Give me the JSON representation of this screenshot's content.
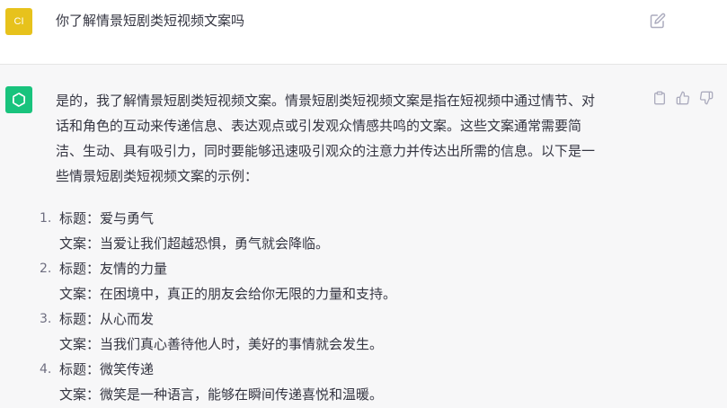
{
  "colors": {
    "user_avatar_bg": "#e7c21c",
    "assistant_avatar_bg": "#19c37d",
    "icon_gray": "#acacbe"
  },
  "user_message": {
    "avatar_initials": "CI",
    "text": "你了解情景短剧类短视频文案吗",
    "edit_icon": "edit-icon"
  },
  "assistant_message": {
    "avatar_icon": "openai-logo-icon",
    "intro_lines": [
      "是的，我了解情景短剧类短视频文案。情景短剧类短视频文案是指在短视频中通过情节、对",
      "话和角色的互动来传递信息、表达观点或引发观众情感共鸣的文案。这些文案通常需要简",
      "洁、生动、具有吸引力，同时要能够迅速吸引观众的注意力并传达出所需的信息。以下是一",
      "些情景短剧类短视频文案的示例："
    ],
    "actions": {
      "copy_icon": "clipboard-icon",
      "thumbs_up_icon": "thumbs-up-icon",
      "thumbs_down_icon": "thumbs-down-icon"
    },
    "examples": [
      {
        "number": "1.",
        "title": "标题：爱与勇气",
        "copy": "文案：当爱让我们超越恐惧，勇气就会降临。"
      },
      {
        "number": "2.",
        "title": "标题：友情的力量",
        "copy": "文案：在困境中，真正的朋友会给你无限的力量和支持。"
      },
      {
        "number": "3.",
        "title": "标题：从心而发",
        "copy": "文案：当我们真心善待他人时，美好的事情就会发生。"
      },
      {
        "number": "4.",
        "title": "标题：微笑传递",
        "copy": "文案：微笑是一种语言，能够在瞬间传递喜悦和温暖。"
      }
    ]
  }
}
